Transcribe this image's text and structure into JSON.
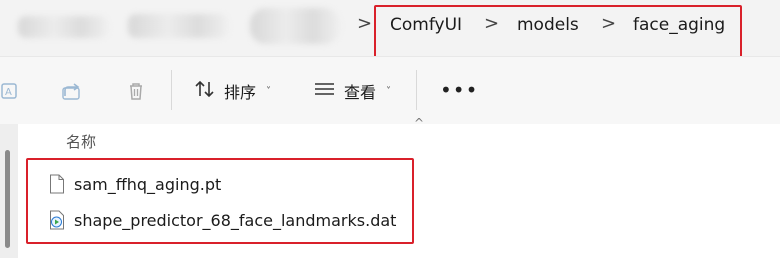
{
  "breadcrumb": {
    "items": [
      "ComfyUI",
      "models",
      "face_aging"
    ],
    "separator": ">"
  },
  "toolbar": {
    "sort_label": "排序",
    "view_label": "查看",
    "more_label": "•••",
    "caret": "˅"
  },
  "file_list": {
    "column_name": "名称",
    "files": [
      {
        "name": "sam_ffhq_aging.pt",
        "icon": "blank-file-icon"
      },
      {
        "name": "shape_predictor_68_face_landmarks.dat",
        "icon": "media-file-icon"
      }
    ]
  },
  "colors": {
    "highlight": "#d9202a",
    "address_bar_bg": "#f3f3f3",
    "toolbar_bg": "#f7f7f7"
  }
}
